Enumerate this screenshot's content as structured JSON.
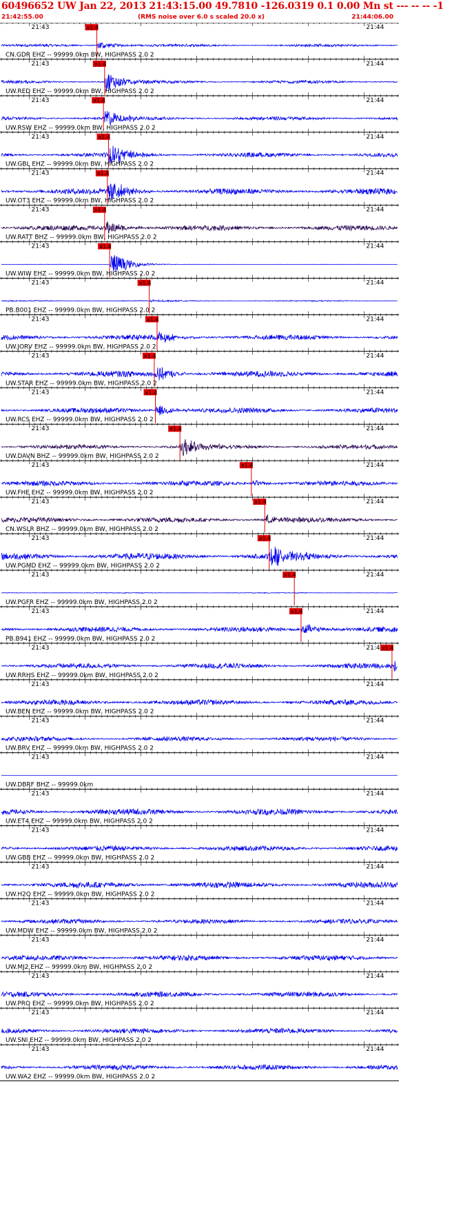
{
  "header": {
    "title": "60496652 UW Jan 22, 2013 21:43:15.00   49.7810 -126.0319  0.1 0.00 Mn st --- -- --  -1",
    "start_time": "21:42:55.00",
    "note": "(RMS noise over 6.0 s scaled 20.0 x)",
    "end_time": "21:44:06.00"
  },
  "colors": {
    "header_text": "#e00000",
    "trace_blue": "#0000ee",
    "trace_dark": "#2a0a55",
    "pick": "#e00000",
    "axis": "#000000"
  },
  "chart_data": {
    "type": "line",
    "title": "60496652 UW Jan 22, 2013 21:43:15.00",
    "x_range": [
      "21:42:55.00",
      "21:44:06.00"
    ],
    "tick_labels": [
      "21:43",
      "21:44"
    ],
    "pick_label": "x1.4",
    "series": [
      {
        "name": "CN.GDR EHZ -- 99999.0km BW, HIGHPASS  2.0  2",
        "color": "blue",
        "pick": "21:43:12.1",
        "quake_strength": 0.9,
        "noise": 0.18
      },
      {
        "name": "UW.RED EHZ -- 99999.0km BW, HIGHPASS  2.0  2",
        "color": "blue",
        "pick": "21:43:13.5",
        "quake_strength": 2.2,
        "noise": 0.2
      },
      {
        "name": "UW.RSW EHZ -- 99999.0km BW, HIGHPASS  2.0  2",
        "color": "blue",
        "pick": "21:43:13.3",
        "quake_strength": 2.0,
        "noise": 0.25
      },
      {
        "name": "UW.GBL EHZ -- 99999.0km BW, HIGHPASS  2.0  2",
        "color": "blue",
        "pick": "21:43:14.2",
        "quake_strength": 2.4,
        "noise": 0.3
      },
      {
        "name": "UW.OT3 EHZ -- 99999.0km BW, HIGHPASS  2.0  2",
        "color": "blue",
        "pick": "21:43:14.0",
        "quake_strength": 2.4,
        "noise": 0.4
      },
      {
        "name": "UW.RATT BHZ -- 99999.0km BW, HIGHPASS  2.0  2",
        "color": "dark",
        "pick": "21:43:13.5",
        "quake_strength": 1.4,
        "noise": 0.35
      },
      {
        "name": "UW.WIW EHZ -- 99999.0km BW, HIGHPASS  2.0  2",
        "color": "blue",
        "pick": "21:43:14.4",
        "quake_strength": 2.6,
        "noise": 0.02
      },
      {
        "name": "PB.B001 EHZ -- 99999.0km BW, HIGHPASS  2.0  2",
        "color": "blue",
        "pick": "21:43:21.5",
        "quake_strength": 0.2,
        "noise": 0.08
      },
      {
        "name": "UW.JORV EHZ -- 99999.0km BW, HIGHPASS  2.0  2",
        "color": "blue",
        "pick": "21:43:22.9",
        "quake_strength": 1.2,
        "noise": 0.35
      },
      {
        "name": "UW.STAR EHZ -- 99999.0km BW, HIGHPASS  2.0  2",
        "color": "blue",
        "pick": "21:43:22.4",
        "quake_strength": 1.6,
        "noise": 0.4
      },
      {
        "name": "UW.RCS EHZ -- 99999.0km BW, HIGHPASS  2.0  2",
        "color": "blue",
        "pick": "21:43:22.6",
        "quake_strength": 1.2,
        "noise": 0.35
      },
      {
        "name": "UW.DAVN BHZ -- 99999.0km BW, HIGHPASS  2.0  2",
        "color": "dark",
        "pick": "21:43:27.0",
        "quake_strength": 1.9,
        "noise": 0.3
      },
      {
        "name": "UW.FHE EHZ -- 99999.0km BW, HIGHPASS  2.0  2",
        "color": "blue",
        "pick": "21:43:39.8",
        "quake_strength": 0.6,
        "noise": 0.35
      },
      {
        "name": "CN.WSLR BHZ -- 99999.0km BW, HIGHPASS  2.0  2",
        "color": "dark",
        "pick": "21:43:42.2",
        "quake_strength": 0.9,
        "noise": 0.35
      },
      {
        "name": "UW.PGMD EHZ -- 99999.0km BW, HIGHPASS  2.0  2",
        "color": "blue",
        "pick": "21:43:43.0",
        "quake_strength": 2.2,
        "noise": 0.45
      },
      {
        "name": "UW.PGFR EHZ -- 99999.0km BW, HIGHPASS  2.0  2",
        "color": "blue",
        "pick": "21:43:47.5",
        "quake_strength": 0.1,
        "noise": 0.05
      },
      {
        "name": "PB.B941 EHZ -- 99999.0km BW, HIGHPASS  2.0  2",
        "color": "blue",
        "pick": "21:43:48.7",
        "quake_strength": 1.3,
        "noise": 0.35
      },
      {
        "name": "UW.RRHS EHZ -- 99999.0km BW, HIGHPASS  2.0  2",
        "color": "blue",
        "pick": "21:44:05.0",
        "quake_strength": 1.0,
        "noise": 0.35
      },
      {
        "name": "UW.BEN EHZ -- 99999.0km BW, HIGHPASS  2.0  2",
        "color": "blue",
        "pick": null,
        "quake_strength": 0,
        "noise": 0.35
      },
      {
        "name": "UW.BRV EHZ -- 99999.0km BW, HIGHPASS  2.0  2",
        "color": "blue",
        "pick": null,
        "quake_strength": 0,
        "noise": 0.3
      },
      {
        "name": "UW.DBRF BHZ -- 99999.0km",
        "color": "blue",
        "pick": null,
        "quake_strength": 0,
        "noise": 0
      },
      {
        "name": "UW.ET4 EHZ -- 99999.0km BW, HIGHPASS  2.0  2",
        "color": "blue",
        "pick": null,
        "quake_strength": 0,
        "noise": 0.4
      },
      {
        "name": "UW.GBB EHZ -- 99999.0km BW, HIGHPASS  2.0  2",
        "color": "blue",
        "pick": null,
        "quake_strength": 0,
        "noise": 0.35
      },
      {
        "name": "UW.H2O EHZ -- 99999.0km BW, HIGHPASS  2.0  2",
        "color": "blue",
        "pick": null,
        "quake_strength": 0,
        "noise": 0.4
      },
      {
        "name": "UW.MDW EHZ -- 99999.0km BW, HIGHPASS  2.0  2",
        "color": "blue",
        "pick": null,
        "quake_strength": 0,
        "noise": 0.3
      },
      {
        "name": "UW.MJ2 EHZ -- 99999.0km BW, HIGHPASS  2.0  2",
        "color": "blue",
        "pick": null,
        "quake_strength": 0,
        "noise": 0.35
      },
      {
        "name": "UW.PRO EHZ -- 99999.0km BW, HIGHPASS  2.0  2",
        "color": "blue",
        "pick": null,
        "quake_strength": 0,
        "noise": 0.35
      },
      {
        "name": "UW.SNI EHZ -- 99999.0km BW, HIGHPASS  2.0  2",
        "color": "blue",
        "pick": null,
        "quake_strength": 0,
        "noise": 0.35
      },
      {
        "name": "UW.WA2 EHZ -- 99999.0km BW, HIGHPASS  2.0  2",
        "color": "blue",
        "pick": null,
        "quake_strength": 0,
        "noise": 0.35
      }
    ]
  }
}
